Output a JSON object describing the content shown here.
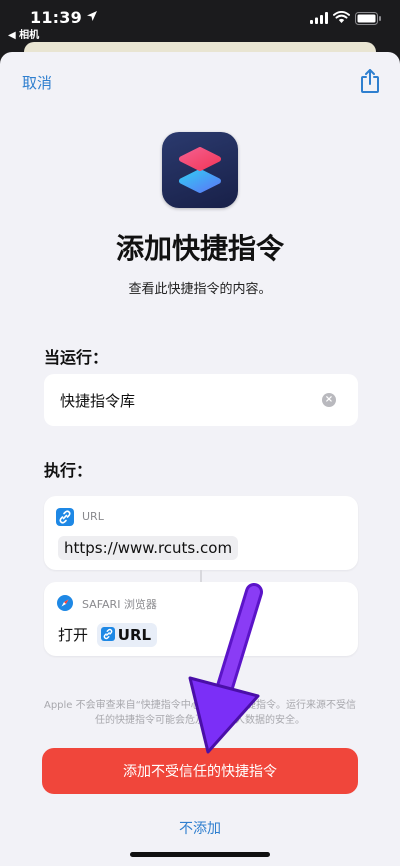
{
  "status_bar": {
    "time": "11:39",
    "back_app": "◀ 相机"
  },
  "sheet": {
    "cancel_label": "取消",
    "title": "添加快捷指令",
    "subtitle": "查看此快捷指令的内容。",
    "when_run_label": "当运行：",
    "when_run_value": "快捷指令库",
    "do_label": "执行：",
    "actions": [
      {
        "name": "URL",
        "token": "https://www.rcuts.com"
      },
      {
        "name": "SAFARI 浏览器",
        "verb": "打开",
        "param": "URL"
      }
    ],
    "disclaimer": "Apple 不会审查来自“快捷指令中心”以外的快捷指令。运行来源不受信任的快捷指令可能会危及您的个人数据的安全。",
    "add_untrusted_label": "添加不受信任的快捷指令",
    "dont_add_label": "不添加"
  },
  "colors": {
    "accent_blue": "#2f7fcf",
    "danger_red": "#f0463b",
    "annotation_purple": "#7b2ff7"
  }
}
